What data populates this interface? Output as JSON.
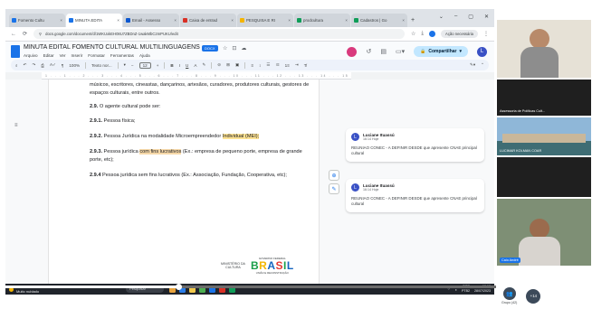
{
  "browser": {
    "tabs": [
      {
        "label": "Fomento Cultu",
        "color": "#1a73e8",
        "active": false
      },
      {
        "label": "MINUTA EDITA",
        "color": "#1a73e8",
        "active": true
      },
      {
        "label": "Email - Assesso",
        "color": "#0b57d0",
        "active": false
      },
      {
        "label": "Caixa de entrad",
        "color": "#d93025",
        "active": false
      },
      {
        "label": "PESQUISA E RI",
        "color": "#f4b400",
        "active": false
      },
      {
        "label": "prodcultura",
        "color": "#0f9d58",
        "active": false
      },
      {
        "label": "Cadastros | Go",
        "color": "#0f9d58",
        "active": false
      }
    ],
    "new_tab": "+",
    "url": "docs.google.com/document/d/1WKUxkEH08U7ZBDnZ-1wakMbC2mPUKU/edit",
    "extra_button": "Ação necessária"
  },
  "doc": {
    "title": "MINUTA EDITAL FOMENTO CULTURAL MULTILINGUAGENS",
    "tag": "DOCX",
    "menu": [
      "Arquivo",
      "Editar",
      "Ver",
      "Inserir",
      "Formatar",
      "Ferramentas",
      "Ajuda"
    ],
    "share_label": "Compartilhar",
    "account_initial": "L",
    "toolbar": {
      "zoom": "100%",
      "style": "Texto nor...",
      "font_size": "12",
      "minus": "−",
      "plus": "+"
    },
    "ruler": "1 . . . 1 . . . 2 . . . 3 . . . 4 . . . 5 . . . 6 . . . 7 . . . 8 . . . 9 . . . 10 . . . 11 . . . 12 . . . 13 . . . 14 . . . 15 . . . 16 . . . 17 . . 18",
    "body": {
      "p0": "músicos, escritores, cineastas, dançarinos, artesãos, curadores, produtores culturais, gestores de espaços culturais, entre outros.",
      "p1_num": "2.9.",
      "p1_text": " O agente cultural pode ser:",
      "p2_num": "2.9.1.",
      "p2_text": " Pessoa física;",
      "p3_num": "2.9.2.",
      "p3_text_a": " Pessoa Jurídica na modalidade Microempreendedor ",
      "p3_text_hl": "Individual (MEI);",
      "p4_num": "2.9.3.",
      "p4_text_a": " Pessoa jurídica ",
      "p4_text_hl": "com fins lucrativos",
      "p4_text_b": " (Ex.: empresa de pequeno porte, empresa de grande porte, etc);",
      "p5_num": "2.9.4",
      "p5_text": " Pessoa jurídica sem fins lucrativos (Ex.: Associação, Fundação, Cooperativa, etc);"
    },
    "footer": {
      "ministry": "MINISTÉRIO DA\nCULTURA",
      "gov_top": "GOVERNO FEDERAL",
      "brasil_letters": [
        "B",
        "R",
        "A",
        "S",
        "I",
        "L"
      ],
      "gov_sub": "UNIÃO E RECONSTRUÇÃO"
    },
    "comments": [
      {
        "initial": "L",
        "author": "Luciane Ituassú",
        "time": "16:14 Hoje",
        "text": "REUNIAO CONEC - A DEFINIR DESDE que apresente CNAE principal cultural"
      },
      {
        "initial": "L",
        "author": "Luciane Ituassú",
        "time": "16:14 Hoje",
        "text": "REUNIAO CONEC - A DEFINIR DESDE que apresente CNAE principal cultural"
      }
    ]
  },
  "taskbar": {
    "weather_temp": "19°C",
    "weather_desc": "Muito nublado",
    "search": "Pesquisar",
    "lang": "POR\nPTB2",
    "time": "16:19\n28/07/2023"
  },
  "meet": {
    "playback_progress": 0.36,
    "participants": [
      {
        "name": ""
      },
      {
        "name": "Assessoria de Políticas Cult..."
      },
      {
        "name": "LUCIMAR KOLMAN COAR"
      },
      {
        "name": ""
      },
      {
        "name": "Caio André"
      }
    ],
    "group_label": "Grupo (42)",
    "more_count": "+14"
  }
}
